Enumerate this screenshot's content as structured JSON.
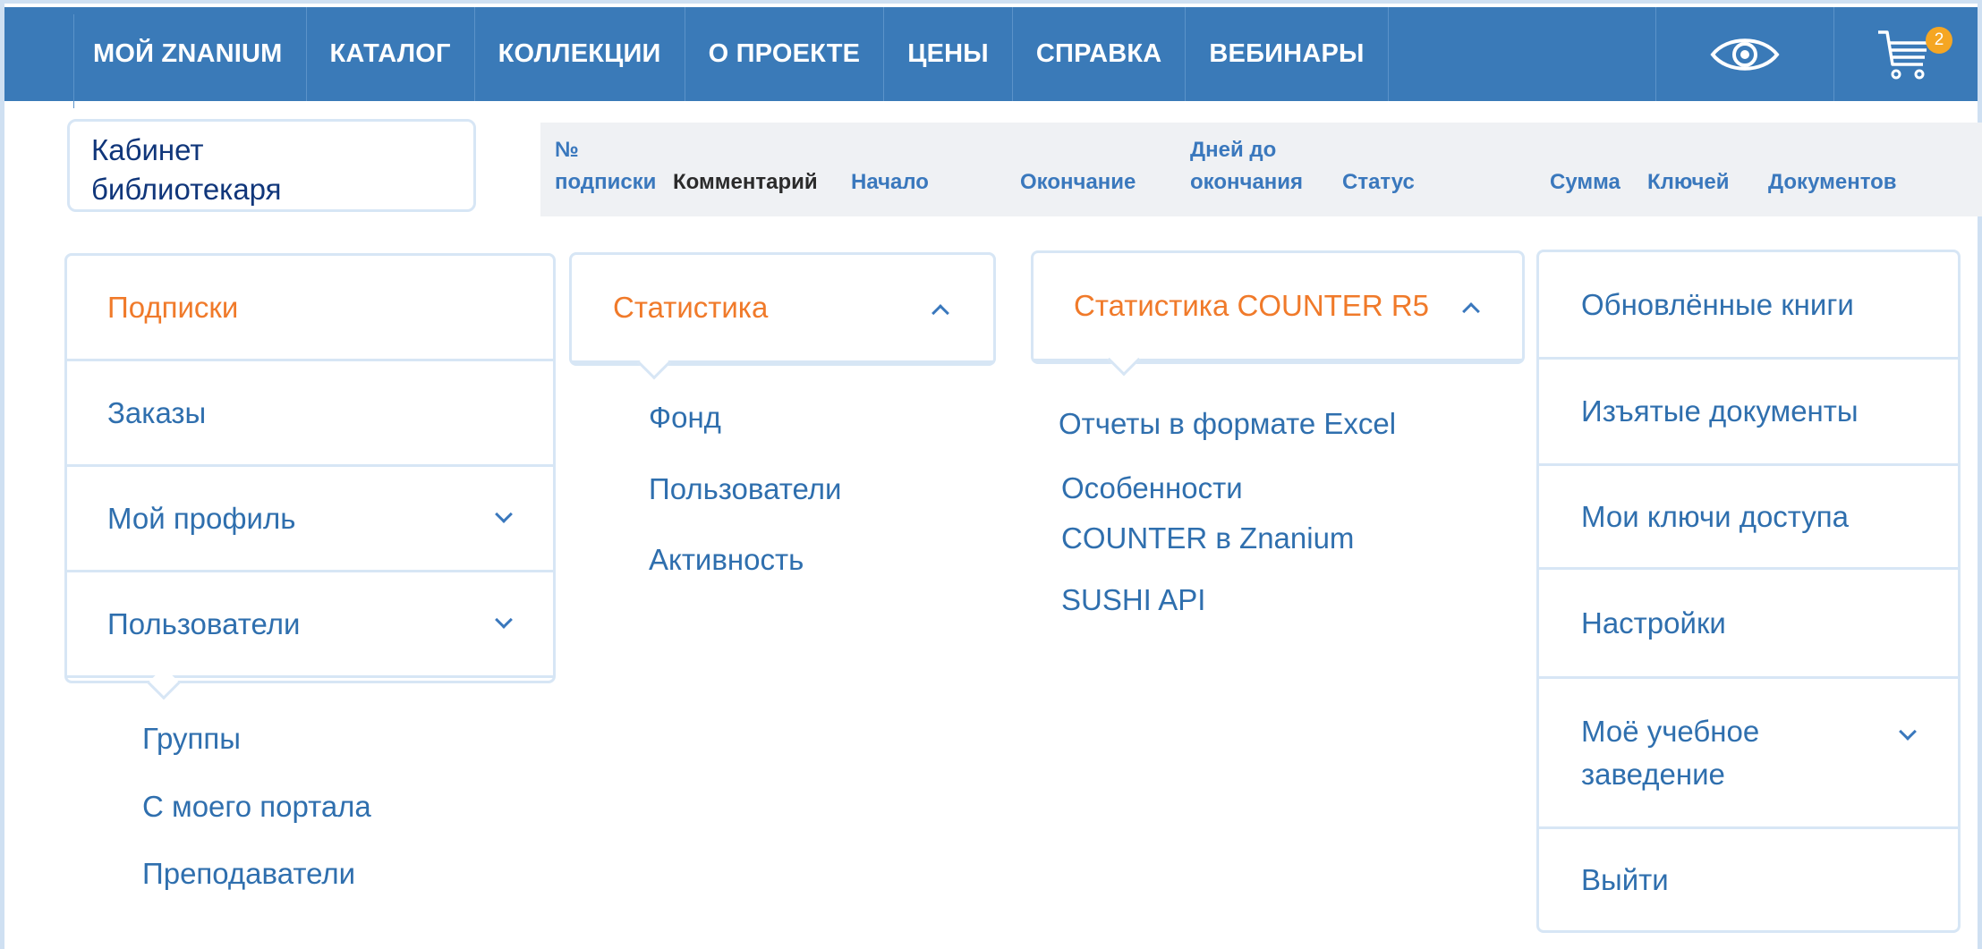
{
  "topnav": {
    "items": [
      "МОЙ ZNANIUM",
      "КАТАЛОГ",
      "КОЛЛЕКЦИИ",
      "О ПРОЕКТЕ",
      "ЦЕНЫ",
      "СПРАВКА",
      "ВЕБИНАРЫ"
    ],
    "eye_icon": "eye-icon",
    "cart_icon": "cart-icon",
    "cart_count": "2"
  },
  "cabinet": {
    "line1": "Кабинет",
    "line2": "библиотекаря"
  },
  "table_header": {
    "number_line1": "№",
    "number_line2": "подписки",
    "comment": "Комментарий",
    "start": "Начало",
    "end": "Окончание",
    "days_line1": "Дней до",
    "days_line2": "окончания",
    "status": "Статус",
    "sum": "Сумма",
    "keys": "Ключей",
    "documents": "Документов"
  },
  "menu_left": {
    "subscriptions": "Подписки",
    "orders": "Заказы",
    "profile": "Мой профиль",
    "users": "Пользователи",
    "users_sub": [
      "Группы",
      "С моего портала",
      "Преподаватели"
    ]
  },
  "menu_stats": {
    "title": "Статистика",
    "items": [
      "Фонд",
      "Пользователи",
      "Активность"
    ]
  },
  "menu_counter": {
    "title": "Статистика COUNTER R5",
    "item1": "Отчеты в формате  Excel",
    "item2_line1": "Особенности",
    "item2_line2": "COUNTER в Znanium",
    "item3": "SUSHI API"
  },
  "menu_right": {
    "items": [
      "Обновлённые книги",
      "Изъятые документы",
      "Мои ключи доступа",
      "Настройки"
    ],
    "institution_line1": "Моё учебное",
    "institution_line2": "заведение",
    "logout": "Выйти"
  },
  "colors": {
    "topbar": "#3a7ab8",
    "accent": "#f07a2a",
    "link": "#2f6fae",
    "cart_badge": "#f5a623"
  }
}
